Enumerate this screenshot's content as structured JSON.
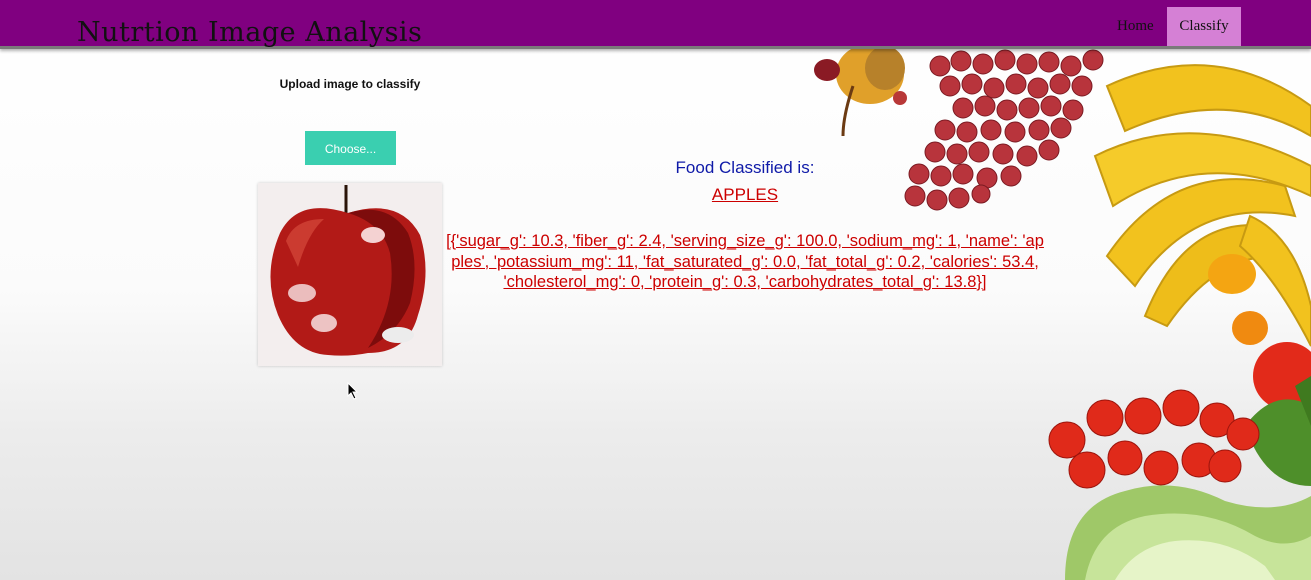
{
  "nav": {
    "brand": "Nutrtion Image Analysis",
    "links": [
      {
        "label": "Home",
        "active": false
      },
      {
        "label": "Classify",
        "active": true
      }
    ]
  },
  "upload": {
    "label": "Upload image to classify",
    "button_label": "Choose..."
  },
  "result": {
    "heading": "Food Classified is:",
    "food": "APPLES",
    "nutrition_text": "[{'sugar_g': 10.3, 'fiber_g': 2.4, 'serving_size_g': 100.0, 'sodium_mg': 1, 'name': 'apples', 'potassium_mg': 11, 'fat_saturated_g': 0.0, 'fat_total_g': 0.2, 'calories': 53.4, 'cholesterol_mg': 0, 'protein_g': 0.3, 'carbohydrates_total_g': 13.8}]"
  },
  "colors": {
    "navbar": "#800080",
    "active_tab": "#d580d5",
    "button": "#3acfb0",
    "heading": "#0f1aa8",
    "result": "#cc0000"
  }
}
